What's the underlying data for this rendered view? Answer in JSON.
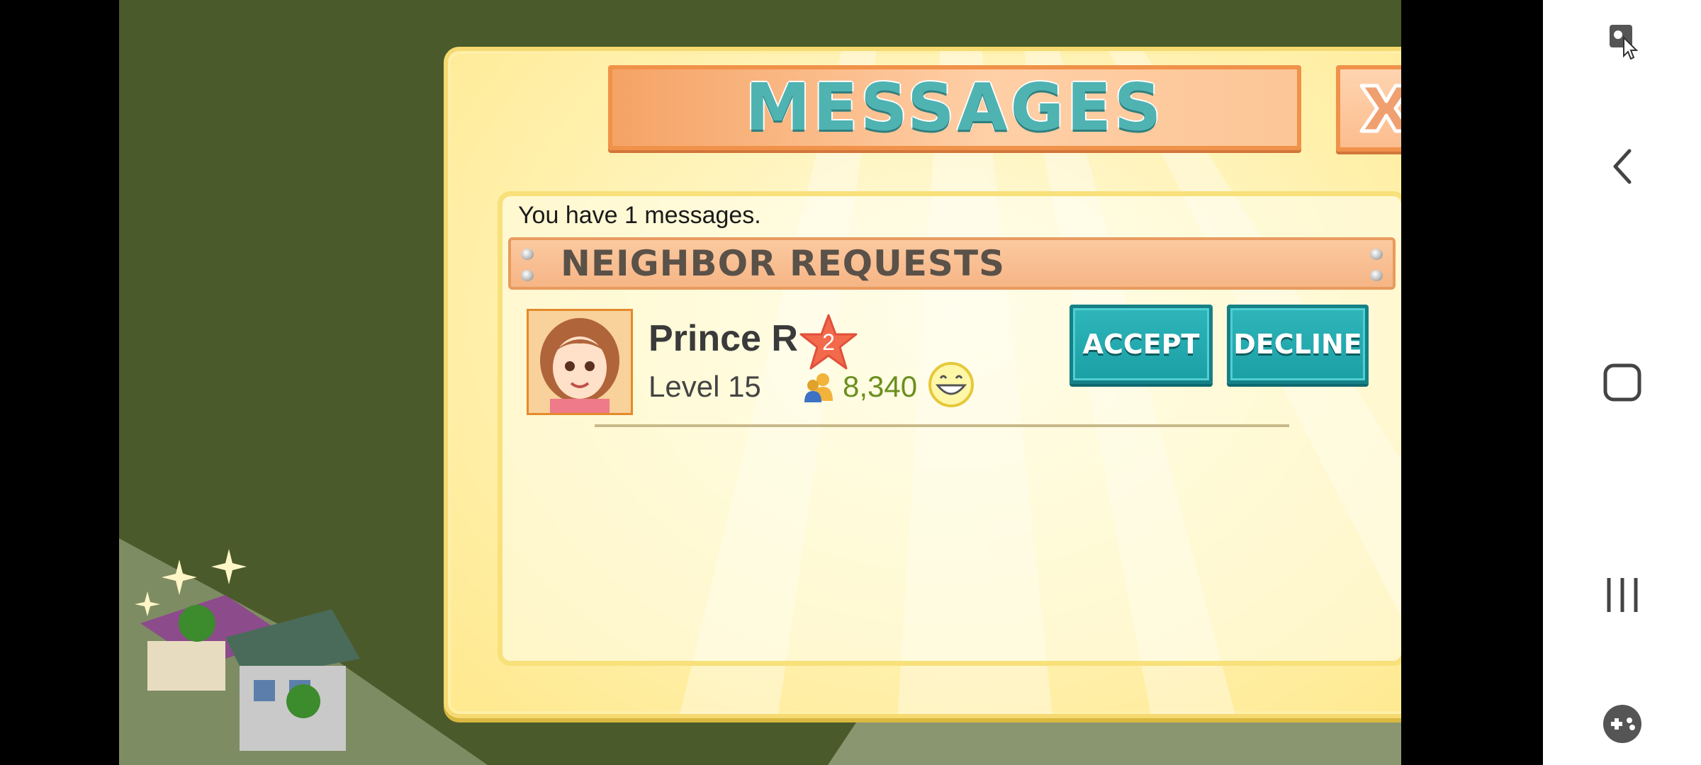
{
  "dialog": {
    "title": "MESSAGES",
    "message_count_text": "You have 1 messages.",
    "section_title": "NEIGHBOR REQUESTS"
  },
  "request": {
    "name": "Prince R",
    "star_level": "2",
    "level_text": "Level 15",
    "neighbors_count": "8,340",
    "accept_label": "ACCEPT",
    "decline_label": "DECLINE"
  },
  "colors": {
    "button_teal": "#1a9fa4",
    "title_teal": "#4fb3b2",
    "plaque_orange": "#f0924a",
    "dialog_yellow": "#fff3b8"
  },
  "icons": {
    "close": "close-x-icon",
    "neighbors": "neighbors-icon",
    "happiness": "happy-face-icon",
    "nav": [
      "screen-record-icon",
      "back-icon",
      "home-icon",
      "recents-icon",
      "game-controller-icon"
    ]
  }
}
